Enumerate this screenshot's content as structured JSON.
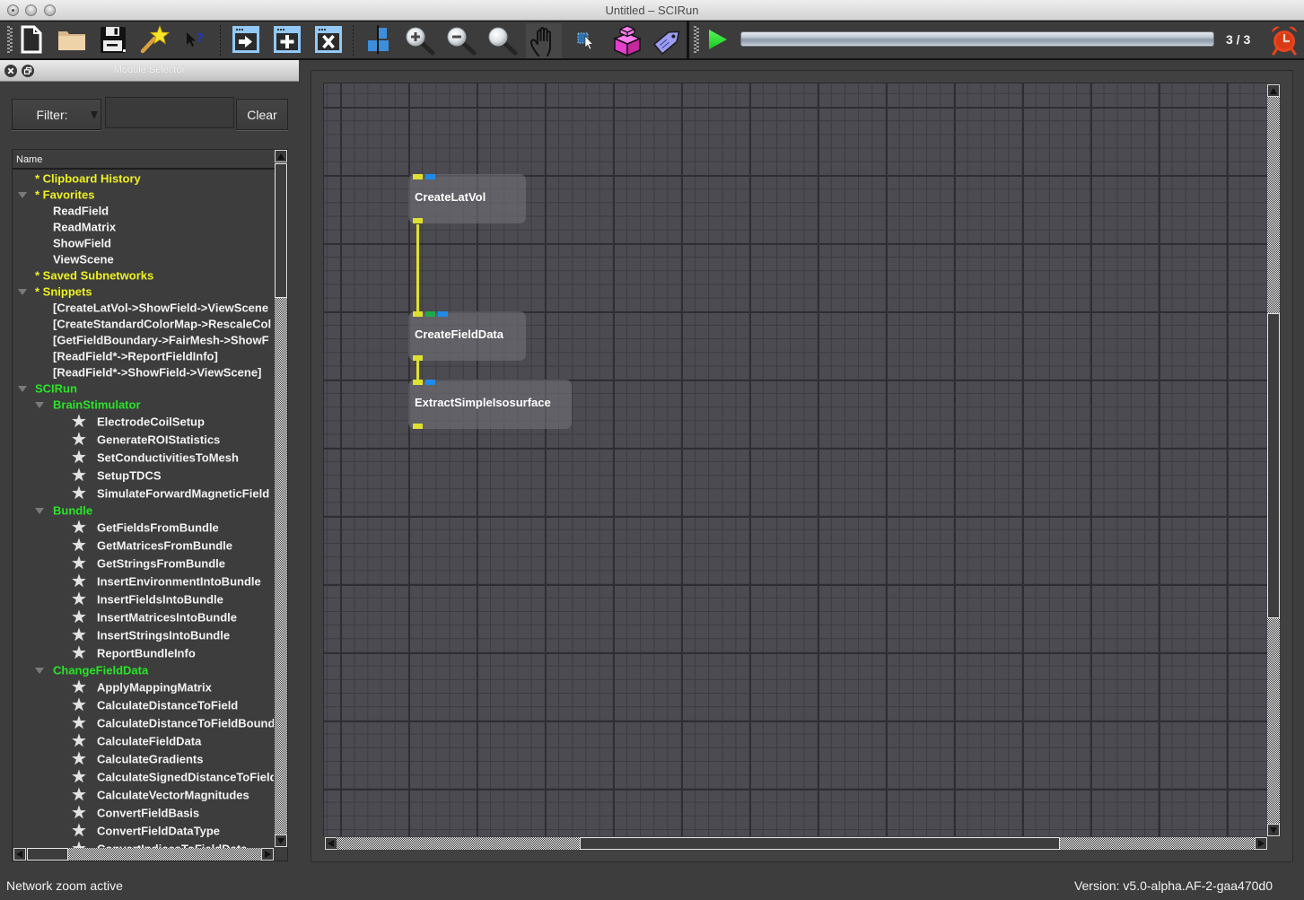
{
  "window": {
    "title": "Untitled – SCIRun",
    "controls": [
      "close",
      "minimize",
      "zoom"
    ]
  },
  "toolbar": {
    "file_icons": [
      "new-network-icon",
      "open-network-icon",
      "save-network-icon",
      "magic-wand-icon",
      "whats-this-icon"
    ],
    "dock_icons": [
      "dock-arrow-icon",
      "dock-add-icon",
      "dock-close-icon"
    ],
    "view_icons": [
      "align-icon",
      "zoom-in-icon",
      "zoom-out-icon",
      "zoom-reset-icon",
      "pan-hand-icon",
      "select-mode-icon",
      "subnetwork-cube-icon",
      "tag-icon"
    ],
    "execute_icon": "play-icon",
    "progress": {
      "label": "3 / 3",
      "fraction": 1.0
    },
    "alarm_icon": "alarm-clock-icon"
  },
  "module_selector": {
    "title": "Module Selector",
    "filter_label": "Filter:",
    "filter_value": "",
    "clear_label": "Clear",
    "column_header": "Name",
    "tree": [
      {
        "label": "* Clipboard History",
        "level": 0,
        "kind": "group"
      },
      {
        "label": "* Favorites",
        "level": 0,
        "kind": "group",
        "expanded": true
      },
      {
        "label": "ReadField",
        "level": 1,
        "kind": "item"
      },
      {
        "label": "ReadMatrix",
        "level": 1,
        "kind": "item"
      },
      {
        "label": "ShowField",
        "level": 1,
        "kind": "item"
      },
      {
        "label": "ViewScene",
        "level": 1,
        "kind": "item"
      },
      {
        "label": "* Saved Subnetworks",
        "level": 0,
        "kind": "group"
      },
      {
        "label": "* Snippets",
        "level": 0,
        "kind": "group",
        "expanded": true
      },
      {
        "label": "[CreateLatVol->ShowField->ViewScene",
        "level": 1,
        "kind": "item"
      },
      {
        "label": "[CreateStandardColorMap->RescaleCol",
        "level": 1,
        "kind": "item"
      },
      {
        "label": "[GetFieldBoundary->FairMesh->ShowF",
        "level": 1,
        "kind": "item"
      },
      {
        "label": "[ReadField*->ReportFieldInfo]",
        "level": 1,
        "kind": "item"
      },
      {
        "label": "[ReadField*->ShowField->ViewScene]",
        "level": 1,
        "kind": "item"
      },
      {
        "label": "SCIRun",
        "level": 0,
        "kind": "category",
        "expanded": true
      },
      {
        "label": "BrainStimulator",
        "level": 1,
        "kind": "category",
        "expanded": true
      },
      {
        "label": "ElectrodeCoilSetup",
        "level": 2,
        "kind": "module"
      },
      {
        "label": "GenerateROIStatistics",
        "level": 2,
        "kind": "module"
      },
      {
        "label": "SetConductivitiesToMesh",
        "level": 2,
        "kind": "module"
      },
      {
        "label": "SetupTDCS",
        "level": 2,
        "kind": "module"
      },
      {
        "label": "SimulateForwardMagneticField",
        "level": 2,
        "kind": "module"
      },
      {
        "label": "Bundle",
        "level": 1,
        "kind": "category",
        "expanded": true
      },
      {
        "label": "GetFieldsFromBundle",
        "level": 2,
        "kind": "module"
      },
      {
        "label": "GetMatricesFromBundle",
        "level": 2,
        "kind": "module"
      },
      {
        "label": "GetStringsFromBundle",
        "level": 2,
        "kind": "module"
      },
      {
        "label": "InsertEnvironmentIntoBundle",
        "level": 2,
        "kind": "module"
      },
      {
        "label": "InsertFieldsIntoBundle",
        "level": 2,
        "kind": "module"
      },
      {
        "label": "InsertMatricesIntoBundle",
        "level": 2,
        "kind": "module"
      },
      {
        "label": "InsertStringsIntoBundle",
        "level": 2,
        "kind": "module"
      },
      {
        "label": "ReportBundleInfo",
        "level": 2,
        "kind": "module"
      },
      {
        "label": "ChangeFieldData",
        "level": 1,
        "kind": "category",
        "expanded": true
      },
      {
        "label": "ApplyMappingMatrix",
        "level": 2,
        "kind": "module"
      },
      {
        "label": "CalculateDistanceToField",
        "level": 2,
        "kind": "module"
      },
      {
        "label": "CalculateDistanceToFieldBoundary",
        "level": 2,
        "kind": "module"
      },
      {
        "label": "CalculateFieldData",
        "level": 2,
        "kind": "module"
      },
      {
        "label": "CalculateGradients",
        "level": 2,
        "kind": "module"
      },
      {
        "label": "CalculateSignedDistanceToField",
        "level": 2,
        "kind": "module"
      },
      {
        "label": "CalculateVectorMagnitudes",
        "level": 2,
        "kind": "module"
      },
      {
        "label": "ConvertFieldBasis",
        "level": 2,
        "kind": "module"
      },
      {
        "label": "ConvertFieldDataType",
        "level": 2,
        "kind": "module"
      },
      {
        "label": "ConvertIndicesToFieldData",
        "level": 2,
        "kind": "module"
      }
    ]
  },
  "network": {
    "port_colors": {
      "field": "#dfe02f",
      "matrix": "#1f8be8",
      "string": "#1fa84a"
    },
    "modules": [
      {
        "name": "CreateLatVol",
        "inputs": [
          "field",
          "matrix"
        ],
        "outputs": [
          "field"
        ]
      },
      {
        "name": "CreateFieldData",
        "inputs": [
          "field",
          "string",
          "matrix"
        ],
        "outputs": [
          "field"
        ]
      },
      {
        "name": "ExtractSimpleIsosurface",
        "inputs": [
          "field",
          "matrix"
        ],
        "outputs": [
          "field"
        ]
      }
    ],
    "connections": [
      {
        "from": "CreateLatVol",
        "to": "CreateFieldData",
        "type": "field"
      },
      {
        "from": "CreateFieldData",
        "to": "ExtractSimpleIsosurface",
        "type": "field"
      }
    ]
  },
  "status": {
    "message": "Network zoom active",
    "version": "Version: v5.0-alpha.AF-2-gaa470d0"
  },
  "colors": {
    "group_text": "#eef024",
    "category_text": "#27e527",
    "play": "#22e030",
    "alarm": "#e8441e"
  }
}
